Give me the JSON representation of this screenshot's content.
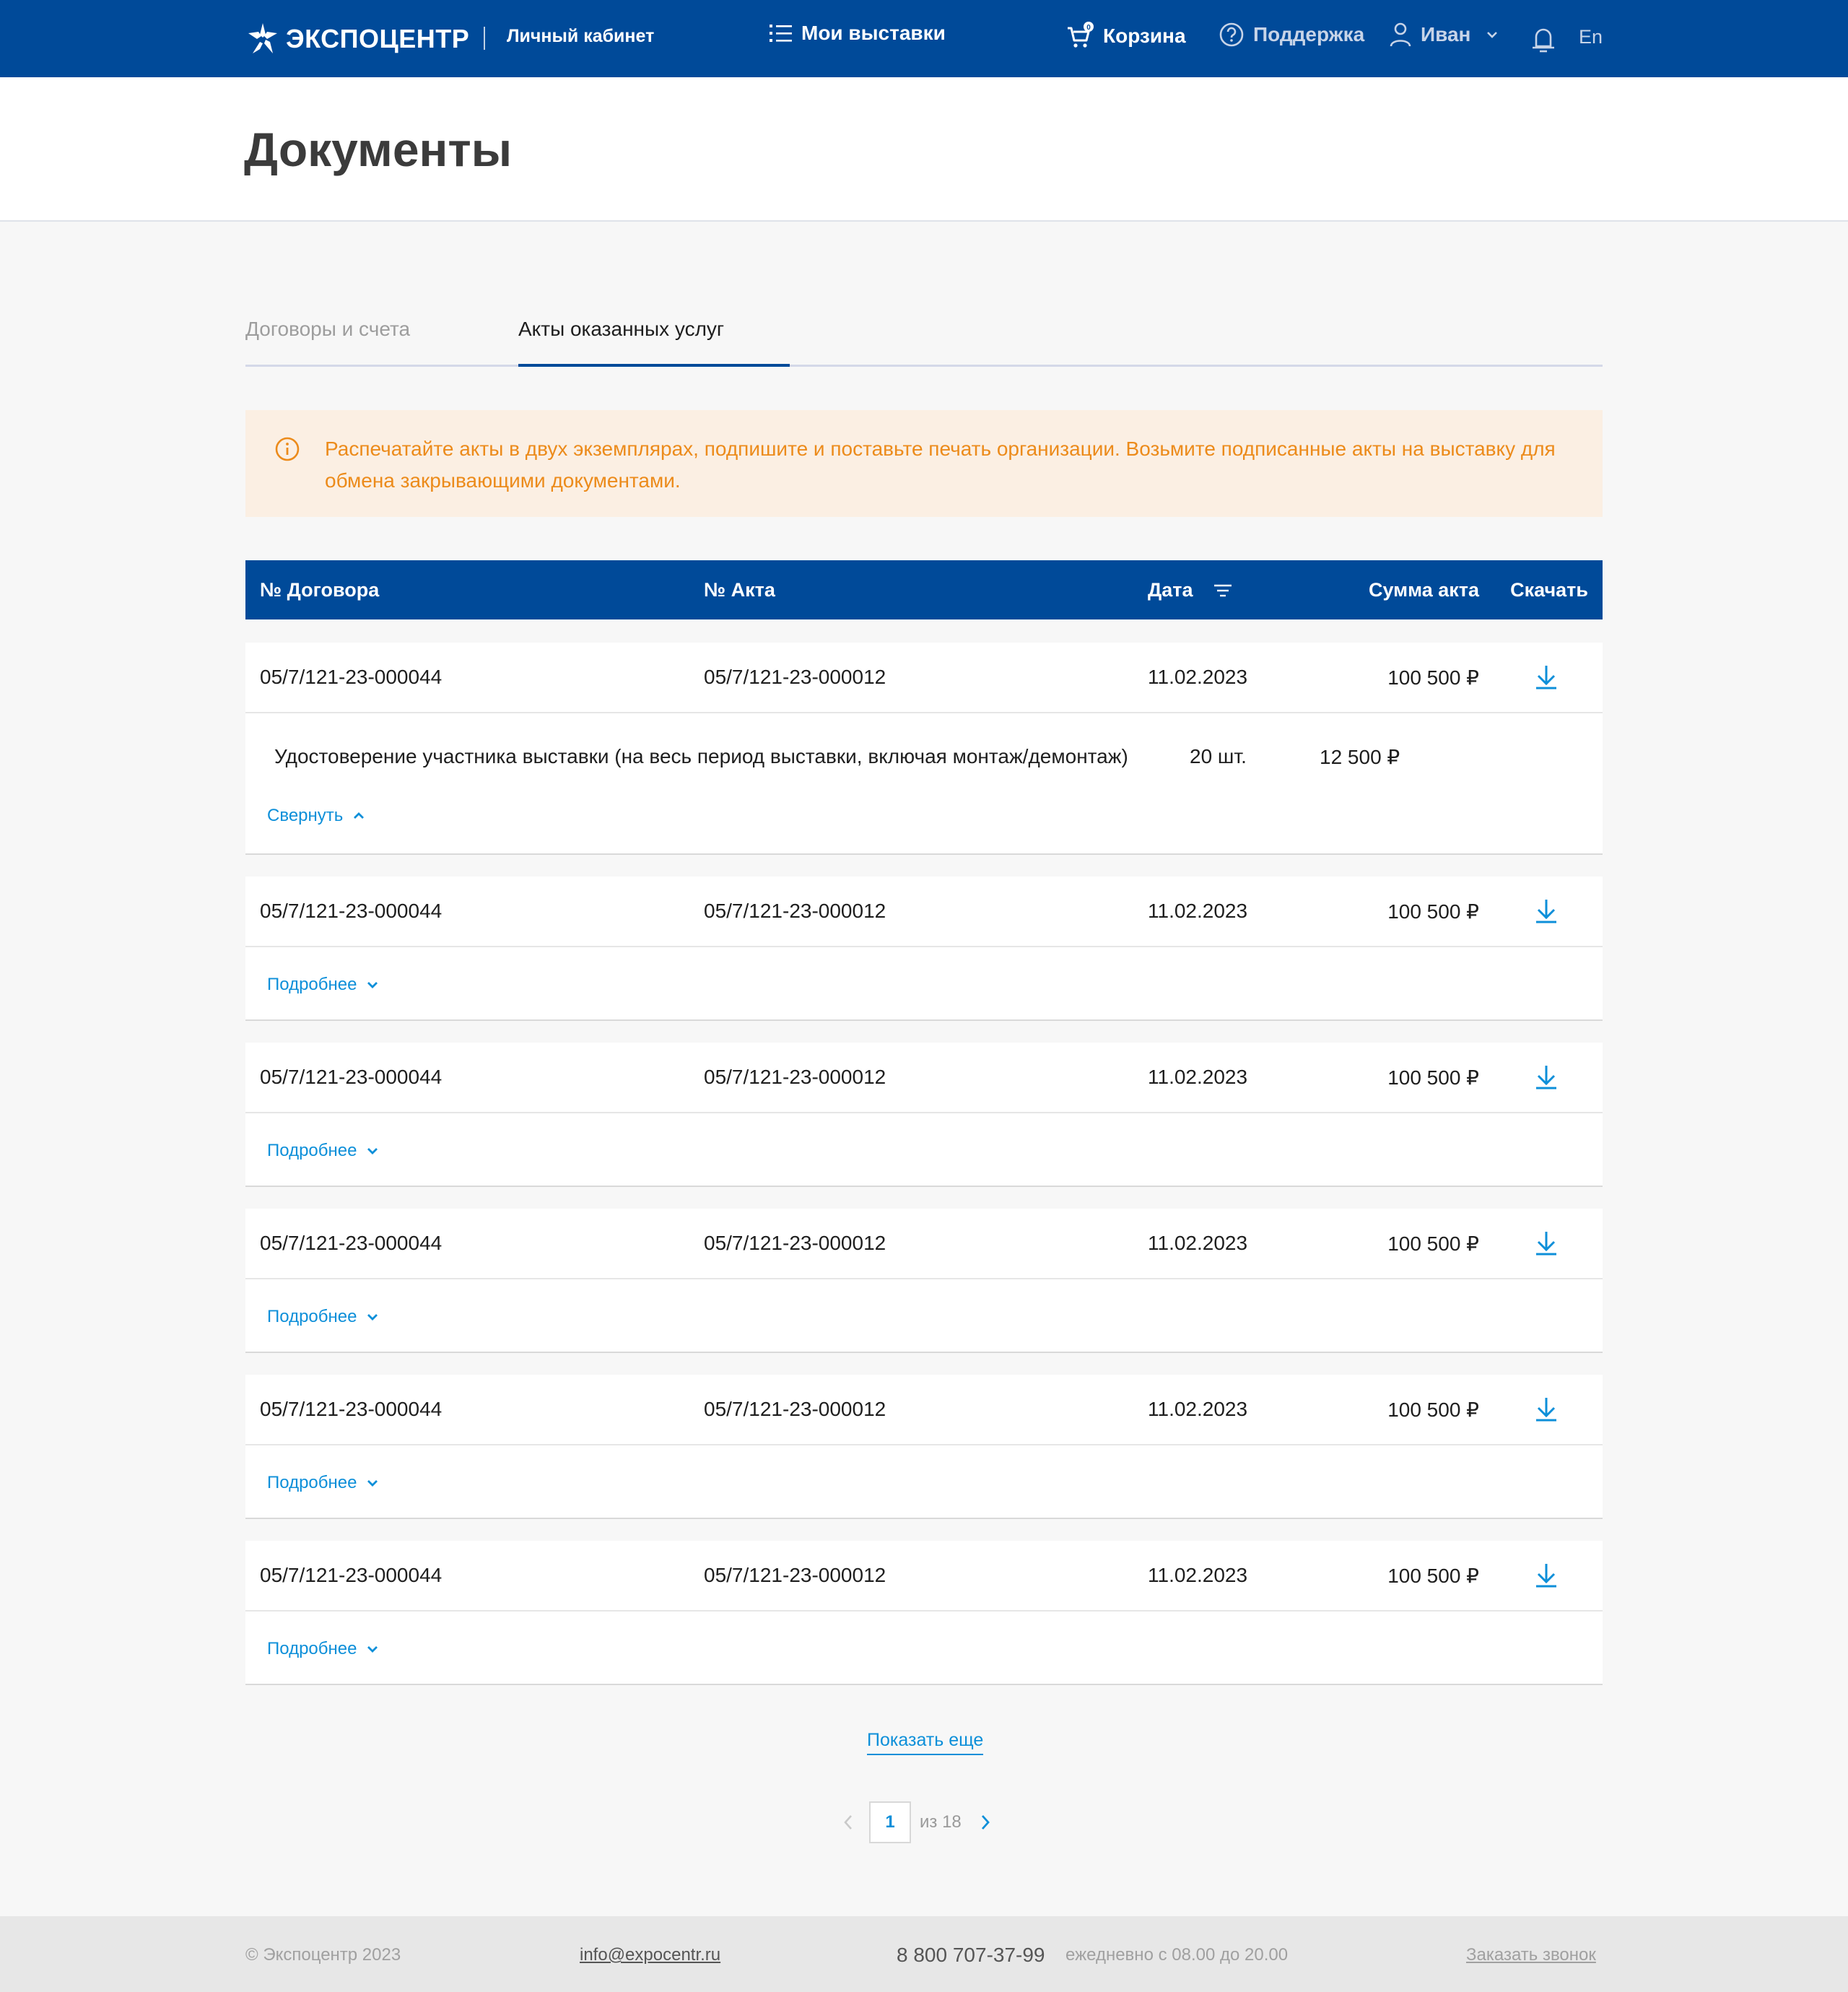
{
  "header": {
    "brand": "ЭКСПОЦЕНТР",
    "cabinet": "Личный кабинет",
    "my_exhibitions": "Мои выставки",
    "cart": "Корзина",
    "cart_badge": "0",
    "support": "Поддержка",
    "user": "Иван",
    "lang": "En"
  },
  "page": {
    "title": "Документы"
  },
  "tabs": [
    {
      "label": "Договоры и счета",
      "active": false
    },
    {
      "label": "Акты оказанных услуг",
      "active": true
    }
  ],
  "notice": {
    "text": "Распечатайте акты в двух экземплярах, подпишите и поставьте печать организации. Возьмите подписанные акты на выставку для обмена закрывающими документами."
  },
  "table": {
    "headers": {
      "contract": "№ Договора",
      "act": "№ Акта",
      "date": "Дата",
      "sum": "Сумма акта",
      "download": "Скачать"
    },
    "rows": [
      {
        "contract": "05/7/121-23-000044",
        "act": "05/7/121-23-000012",
        "date": "11.02.2023",
        "sum": "100 500 ₽",
        "expanded": true,
        "toggle": "Свернуть",
        "detail": {
          "name": "Удостоверение участника выставки (на весь период выставки, включая монтаж/демонтаж)",
          "qty": "20 шт.",
          "price": "12 500 ₽"
        }
      },
      {
        "contract": "05/7/121-23-000044",
        "act": "05/7/121-23-000012",
        "date": "11.02.2023",
        "sum": "100 500 ₽",
        "expanded": false,
        "toggle": "Подробнее"
      },
      {
        "contract": "05/7/121-23-000044",
        "act": "05/7/121-23-000012",
        "date": "11.02.2023",
        "sum": "100 500 ₽",
        "expanded": false,
        "toggle": "Подробнее"
      },
      {
        "contract": "05/7/121-23-000044",
        "act": "05/7/121-23-000012",
        "date": "11.02.2023",
        "sum": "100 500 ₽",
        "expanded": false,
        "toggle": "Подробнее"
      },
      {
        "contract": "05/7/121-23-000044",
        "act": "05/7/121-23-000012",
        "date": "11.02.2023",
        "sum": "100 500 ₽",
        "expanded": false,
        "toggle": "Подробнее"
      },
      {
        "contract": "05/7/121-23-000044",
        "act": "05/7/121-23-000012",
        "date": "11.02.2023",
        "sum": "100 500 ₽",
        "expanded": false,
        "toggle": "Подробнее"
      }
    ]
  },
  "pagination": {
    "show_more": "Показать еще",
    "current": "1",
    "of_label": "из 18"
  },
  "footer": {
    "copyright": "© Экспоцентр 2023",
    "email": "info@expocentr.ru",
    "phone": "8 800 707-37-99",
    "hours": "ежедневно с 08.00 до 20.00",
    "callback": "Заказать звонок"
  },
  "colors": {
    "primary": "#004a99",
    "link": "#0d8fd9",
    "notice_bg": "#fbefe3",
    "notice_text": "#ec8b1b"
  }
}
